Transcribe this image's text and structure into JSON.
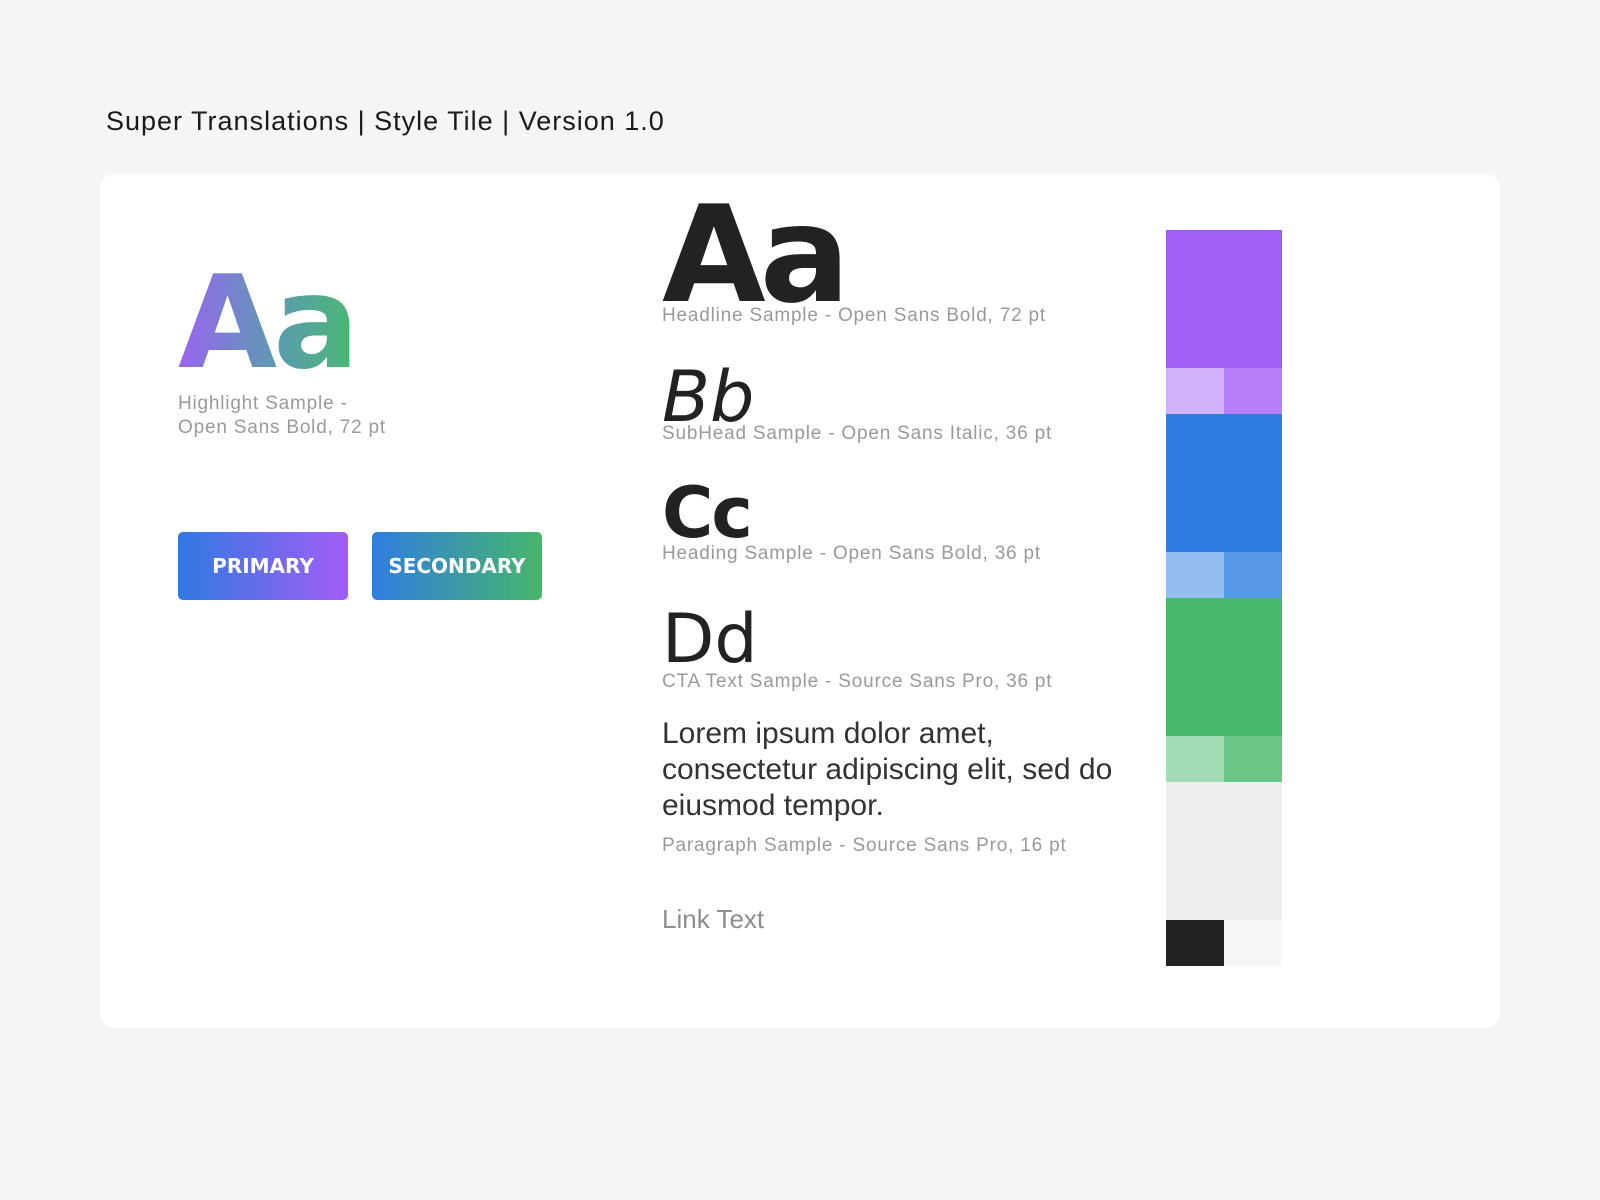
{
  "header": {
    "title": "Super Translations | Style Tile | Version 1.0"
  },
  "highlight": {
    "sample": "Aa",
    "caption_line1": "Highlight Sample -",
    "caption_line2": "Open Sans Bold, 72 pt"
  },
  "buttons": {
    "primary_label": "PRIMARY",
    "secondary_label": "SECONDARY"
  },
  "typography": {
    "headline": {
      "sample": "Aa",
      "caption": "Headline Sample - Open Sans Bold, 72 pt"
    },
    "subhead": {
      "sample": "Bb",
      "caption": "SubHead Sample - Open Sans Italic, 36 pt"
    },
    "heading": {
      "sample": "Cc",
      "caption": "Heading Sample - Open Sans Bold, 36 pt"
    },
    "cta": {
      "sample": "Dd",
      "caption": "CTA Text Sample - Source Sans Pro, 36 pt"
    },
    "paragraph": {
      "text": "Lorem ipsum dolor amet, consectetur adipiscing elit, sed do eiusmod tempor.",
      "caption": "Paragraph Sample - Source Sans Pro, 16 pt"
    },
    "link": {
      "text": "Link Text"
    }
  },
  "palette": {
    "purple": {
      "main": "#a15ff8",
      "light": "#d2b1fb",
      "mid": "#b67ef9"
    },
    "blue": {
      "main": "#2e7ee1",
      "light": "#95bdf0",
      "mid": "#5798e7"
    },
    "green": {
      "main": "#48b769",
      "light": "#a3dcb4",
      "mid": "#6bc587"
    },
    "neutral": {
      "main": "#efefef",
      "dark": "#222222",
      "light": "#f6f6f6"
    }
  }
}
